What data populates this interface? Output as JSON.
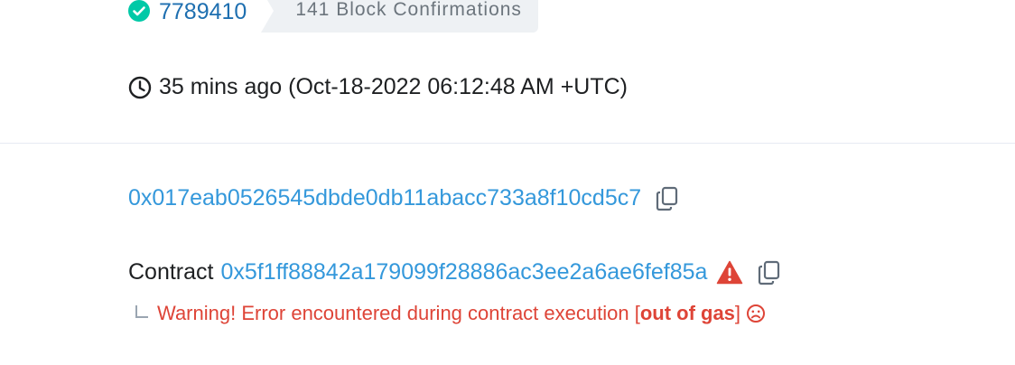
{
  "block": {
    "number": "7789410",
    "confirmations": "141 Block Confirmations",
    "status_icon": "check-circle-icon",
    "status_color": "#00c9a7"
  },
  "timestamp": {
    "text": "35 mins ago (Oct-18-2022 06:12:48 AM +UTC)",
    "icon": "clock-icon"
  },
  "from": {
    "address": "0x017eab0526545dbde0db11abacc733a8f10cd5c7",
    "copy_icon": "copy-icon"
  },
  "to": {
    "label": "Contract",
    "address": "0x5f1ff88842a179099f28886ac3ee2a6ae6fef85a",
    "alert_icon": "warning-triangle-icon",
    "copy_icon": "copy-icon"
  },
  "warning": {
    "prefix": "Warning! Error encountered during contract execution [",
    "strong": "out of gas",
    "suffix": "]",
    "icon": "sad-face-icon",
    "color": "#de4437"
  },
  "colors": {
    "link": "#3498db",
    "block_link": "#1e6fb0",
    "badge_bg": "#eef1f4",
    "danger": "#de4437"
  }
}
